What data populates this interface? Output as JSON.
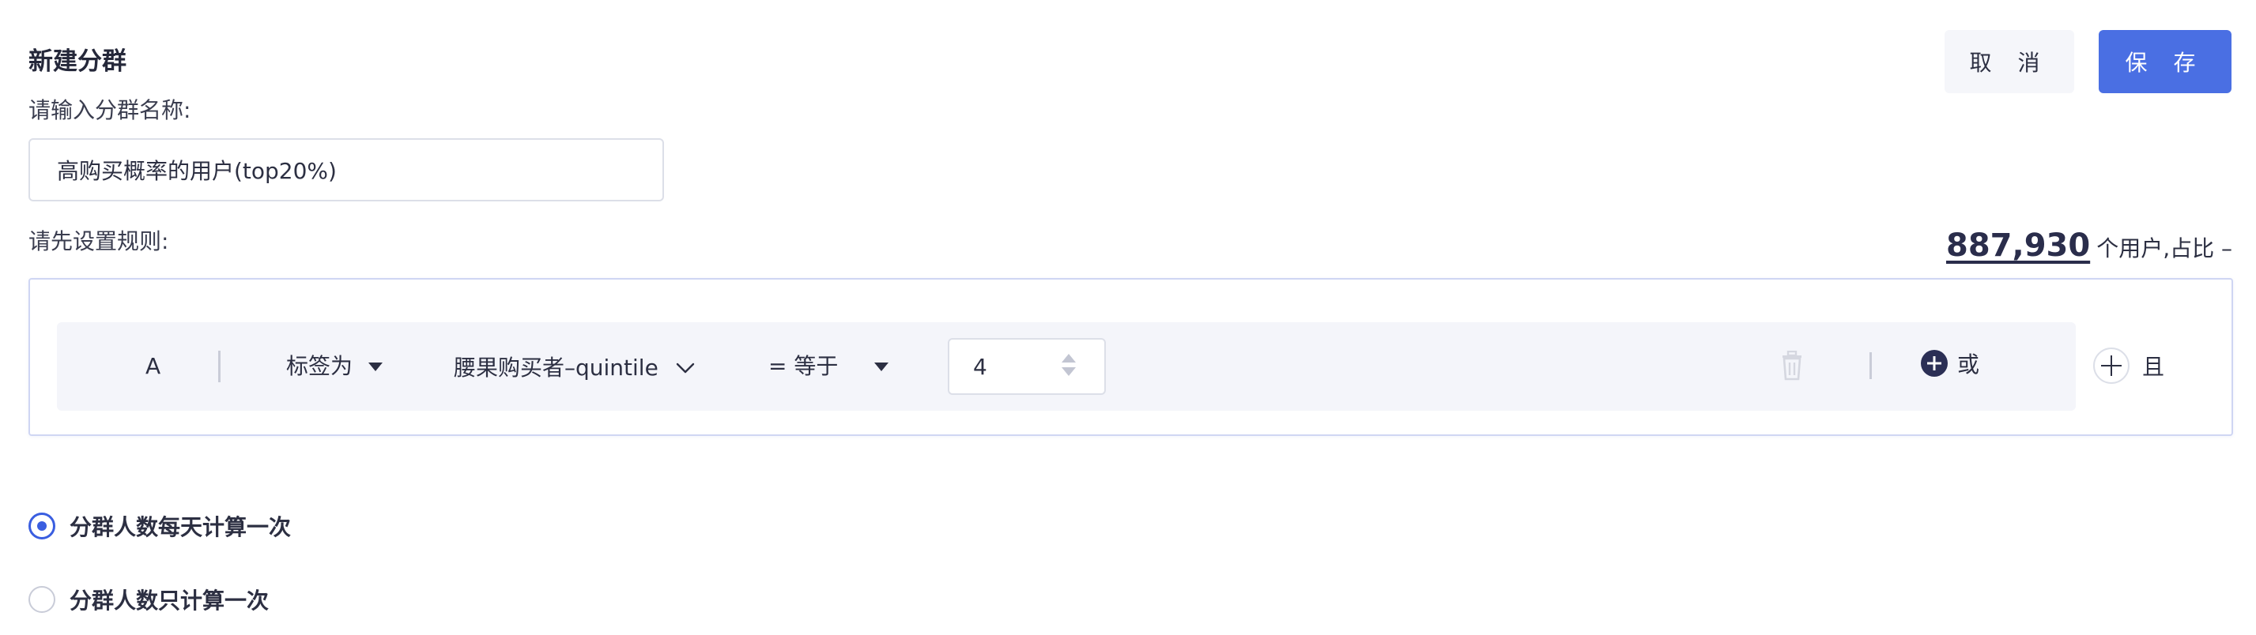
{
  "header": {
    "title": "新建分群",
    "cancel_label": "取 消",
    "save_label": "保 存"
  },
  "name_section": {
    "label": "请输入分群名称:",
    "value": "高购买概率的用户(top20%)"
  },
  "rules_section": {
    "label": "请先设置规则:",
    "user_count": "887,930",
    "user_count_suffix": "个用户,占比 –",
    "rule": {
      "group_letter": "A",
      "type_label": "标签为",
      "tag_name": "腰果购买者–quintile",
      "operator_label": "= 等于",
      "value": "4",
      "or_label": "或"
    },
    "and_label": "且"
  },
  "calc_options": {
    "options": [
      {
        "label": "分群人数每天计算一次",
        "selected": true
      },
      {
        "label": "分群人数只计算一次",
        "selected": false
      }
    ]
  },
  "colors": {
    "accent": "#4a6fe3",
    "radio_active": "#3a5ee0",
    "text": "#2c2f42"
  },
  "icons": [
    "caret-down-icon",
    "chevron-down-icon",
    "spinner-icon",
    "trash-icon",
    "plus-circle-icon",
    "plus-icon"
  ]
}
